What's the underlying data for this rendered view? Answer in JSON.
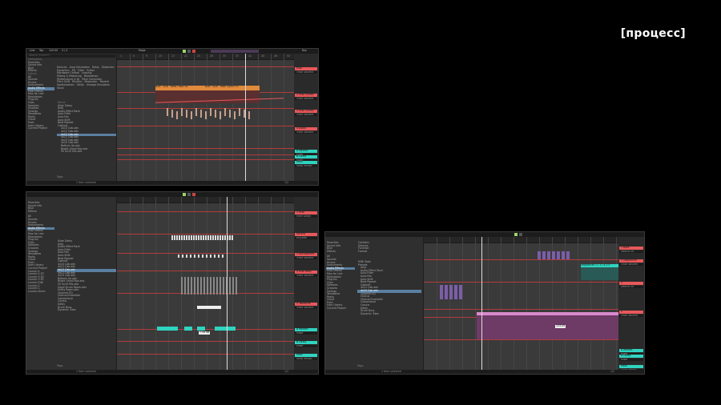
{
  "heading": "[процесс]",
  "colors": {
    "track_red": "#e8585b",
    "clip_orange": "#e08a3c",
    "clip_cyan": "#2fd4c0",
    "clip_pink": "#d98acb",
    "clip_purple": "#7b5ea8",
    "accent_green": "#9bd46b"
  },
  "screen1": {
    "top": {
      "link": "Link",
      "tap": "Tap",
      "tempo": "120.00",
      "sig": "4 / 4",
      "key": "Major",
      "key_label": "Key"
    },
    "browser": {
      "search": "Search (Cmd+F)",
      "collections_head": "Collections",
      "collections": [
        "Favorites",
        "Sound Info",
        "Blue",
        "Effects"
      ],
      "places_head": "Library",
      "places": [
        "All",
        "Sounds",
        "Drums",
        "Instruments",
        "Audio Effects",
        "MIDI Effects",
        "Max for Live",
        "Modulators",
        "Plug-Ins",
        "Clips",
        "Samples",
        "Grooves",
        "Tunings",
        "Templates"
      ],
      "places2": [
        "Packs",
        "Cloud",
        "Push",
        "User Library",
        "Current Project"
      ],
      "filters": [
        "Devices",
        "Amp Simulation",
        "Delay",
        "Distortion",
        "Dynamics",
        "EQ",
        "Filter",
        "Guitar",
        "Hardware Control",
        "Looping",
        "Mixing & Mastering",
        "Modulation",
        "Performance & DJ",
        "Pitch Correction",
        "Pitch Shift",
        "Rhythm",
        "Resonator",
        "Reverb",
        "Spatialization",
        "Utility",
        "Vintage Emulation",
        "Vocal"
      ],
      "items_head": "Name",
      "items": [
        "Align Delay",
        "Amp",
        "Audio Effect Rack",
        "Auto Filter",
        "Auto Pan",
        "Auto Shift",
        "Beat Repeat",
        "Cabinet",
        "4x10 Cab.adv",
        "4x12 Cab.adv",
        "4x12 Cab.adv",
        "4x12 Cab.adv",
        "4x10 Cab.adv",
        "4x10 Cab.adv",
        "Bottom Up.adv",
        "Bright Small Box.adv",
        "SS 4x10 Mix.adv"
      ],
      "tags": "Tags:"
    },
    "clips": [
      "B2B · A2B · Beat / 8bit Xs",
      "B2B · B2b · Main Synth P3"
    ],
    "mixer": [
      {
        "name": "MIDI",
        "sub": "Track Volume"
      },
      {
        "name": "2 MIDI Drums",
        "sub": "Track Volume"
      },
      {
        "name": "3 MIDI Drums",
        "sub": "Track Volume"
      },
      {
        "name": "4 Audio",
        "sub": "Track Volume"
      },
      {
        "name": "A Reverb",
        "sub": "Mixer"
      },
      {
        "name": "B Delay",
        "sub": "Mixer"
      },
      {
        "name": "Main",
        "sub": "Song Tempo"
      }
    ],
    "ruler_marks": [
      "1",
      "5",
      "9",
      "13",
      "17",
      "21",
      "25",
      "29",
      "33",
      "37",
      "41",
      "45",
      "49",
      "53"
    ],
    "status": [
      "0:00",
      "0:30",
      "1:00",
      "1:30",
      "2:00",
      "2:30",
      "3:00",
      "3:30",
      "4:00",
      "4:30"
    ],
    "sel_info": "1 Item selected",
    "page": "1/2"
  },
  "screen2": {
    "browser": {
      "collections": [
        "Favorites",
        "Sound Info",
        "Blue",
        "Effects"
      ],
      "places": [
        "All",
        "Sounds",
        "Drums",
        "Instruments",
        "Audio Effects",
        "MIDI Effects",
        "Max for Live",
        "Modulators",
        "Plug-Ins",
        "Clips",
        "Samples",
        "Grooves",
        "Tunings",
        "Templates"
      ],
      "places2": [
        "Packs",
        "Cloud",
        "Push",
        "User Library",
        "Current Project",
        "Launch 4",
        "Launch 4 DT",
        "Launch 3 DT",
        "Launch 3 DT",
        "Launch Edit",
        "Launch C",
        "Launch C",
        "Launch Drum"
      ],
      "items": [
        "Align Delay",
        "Amp",
        "Audio Effect Rack",
        "Auto Filter",
        "Auto Pan",
        "Auto Shift",
        "Beat Repeat",
        "Cabinet",
        "4x10 Cab.adv",
        "4x12 Cab.adv",
        "4x12 Cab.adv",
        "4x12 Cab.adv",
        "4x10 Cab.adv",
        "Bottom Up.adv",
        "Bright Small Box.adv",
        "SS 4x10 Mix.adv",
        "Small Drum Room.adv",
        "Utility Room.adv",
        "Channel EQ",
        "Chorus-Ensemble",
        "Compressor",
        "Corpus",
        "Delay",
        "Drum Buss",
        "Dynamic Tube"
      ],
      "tags": "Tags:"
    },
    "mixer": [
      {
        "name": "1 MIDI",
        "sub": "Filter Delay"
      },
      {
        "name": "Reverb",
        "sub": "Dry/Wet"
      },
      {
        "name": "3 Atmosphere",
        "sub": "Track Volume"
      },
      {
        "name": "4 MIDI Bass",
        "sub": "Track Volume"
      },
      {
        "name": "5 Tablature",
        "sub": "Track Volume"
      },
      {
        "name": "A Reverb",
        "sub": "Mixer"
      },
      {
        "name": "B Delay",
        "sub": "Mixer"
      },
      {
        "name": "Main",
        "sub": "Song Tempo"
      }
    ],
    "value_label": "7.56 dB",
    "sel_info": "1 Item selected",
    "page": "1/2"
  },
  "screen3": {
    "browser": {
      "collections": [
        "Favorites",
        "Sound Info",
        "Blue",
        "Effects"
      ],
      "places": [
        "All",
        "Sounds",
        "Drums",
        "Instruments",
        "Audio Effects",
        "MIDI Effects",
        "Max for Live",
        "Modulators",
        "Plug-Ins",
        "Clips",
        "Samples",
        "Grooves",
        "Tunings",
        "Templates"
      ],
      "places2": [
        "Packs",
        "Cloud",
        "Push",
        "User Library",
        "Current Project"
      ],
      "filters": [
        "Contains",
        "Devices",
        "Function",
        "Format"
      ],
      "items": [
        "MIDI Tools",
        "Presets",
        "Amp",
        "Audio Effect Rack",
        "Auto Filter",
        "Auto Pan",
        "Auto Shift",
        "Beat Repeat",
        "Cabinet",
        "4x12 Cab.adv",
        "4x10 Cab.adv",
        "Channel EQ",
        "Chorus",
        "Chorus-Ensemble",
        "Compressor",
        "Corpus",
        "Delay",
        "Drum Buss",
        "Dynamic Tube"
      ],
      "tags": "Tags:"
    },
    "clips": [
      "Sequence 1",
      "Sequencer 1 / 1 / 4.3 5"
    ],
    "mixer": [
      {
        "name": "1 Bass",
        "sub": "Device On"
      },
      {
        "name": "2 Sequencer",
        "sub": "Track Volume"
      },
      {
        "name": "3",
        "sub": "Device On"
      },
      {
        "name": "4",
        "sub": "Track Volume"
      },
      {
        "name": "A Reverb",
        "sub": "Mixer"
      },
      {
        "name": "B Delay",
        "sub": "Mixer"
      },
      {
        "name": "Main",
        "sub": "Song Tempo"
      }
    ],
    "value_label": "123.45",
    "sel_info": "1 Item selected",
    "page": "1/2"
  }
}
